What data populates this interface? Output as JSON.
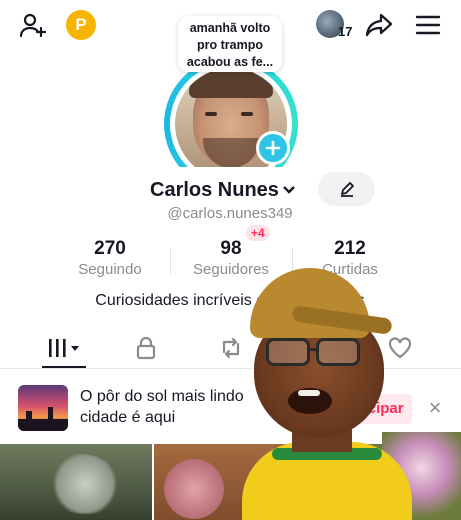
{
  "header": {
    "notification_count": "17",
    "coin_symbol": "P",
    "story_bubble": "amanhã volto pro trampo acabou as fe..."
  },
  "profile": {
    "name": "Carlos Nunes",
    "username": "@carlos.nunes349",
    "bio": "Curiosidades incríveis e interessantes"
  },
  "stats": [
    {
      "value": "270",
      "label": "Seguindo"
    },
    {
      "value": "98",
      "label": "Seguidores",
      "badge": "+4"
    },
    {
      "value": "212",
      "label": "Curtidas"
    }
  ],
  "banner": {
    "text": "O pôr do sol mais lindo cidade é aqui",
    "button": "Participar",
    "close": "×"
  },
  "colors": {
    "accent": "#fe2c55",
    "ring": "#25d3e0",
    "coin": "#f6b400"
  },
  "tabs": [
    "videos-grid",
    "private",
    "reposts",
    "favorites",
    "liked"
  ]
}
